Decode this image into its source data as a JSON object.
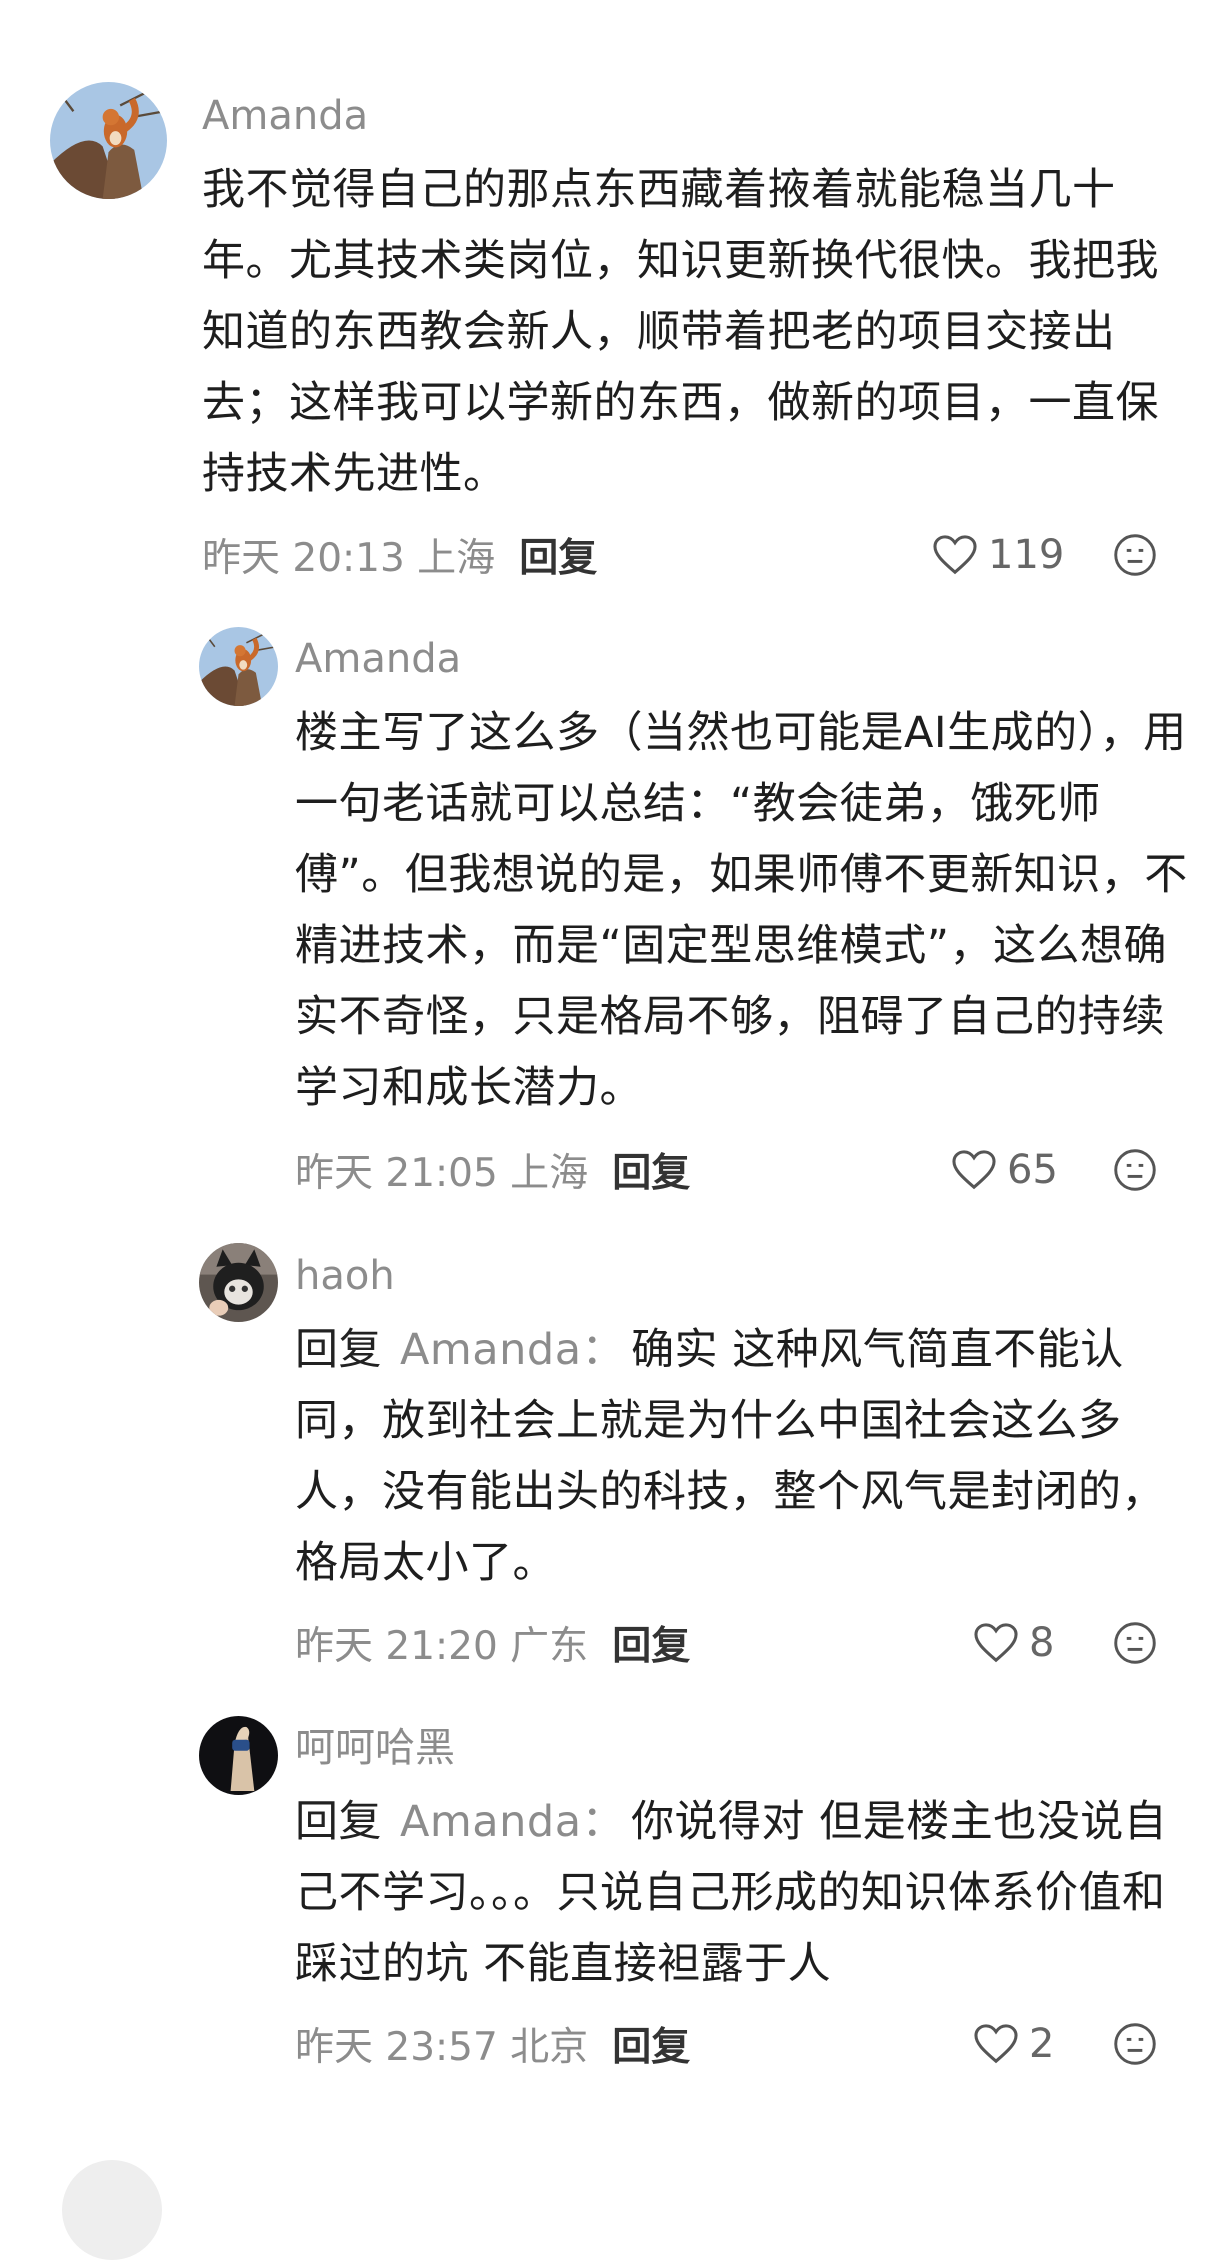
{
  "comments": [
    {
      "author": "Amanda",
      "text": "我不觉得自己的那点东西藏着掖着就能稳当几十年。尤其技术类岗位，知识更新换代很快。我把我知道的东西教会新人，顺带着把老的项目交接出去；这样我可以学新的东西，做新的项目，一直保持技术先进性。",
      "time": "昨天 20:13 上海",
      "reply_label": "回复",
      "likes": "119",
      "avatar_icon": "squirrel-avatar"
    },
    {
      "author": "Amanda",
      "text": "楼主写了这么多（当然也可能是AI生成的），用一句老话就可以总结：“教会徒弟，饿死师傅”。但我想说的是，如果师傅不更新知识，不精进技术，而是“固定型思维模式”，这么想确实不奇怪，只是格局不够，阻碍了自己的持续学习和成长潜力。",
      "time": "昨天 21:05 上海",
      "reply_label": "回复",
      "likes": "65",
      "avatar_icon": "squirrel-avatar"
    },
    {
      "author": "haoh",
      "reply_prefix": "回复",
      "reply_target": "Amanda：",
      "text": "确实 这种风气简直不能认同，放到社会上就是为什么中国社会这么多人，没有能出头的科技，整个风气是封闭的，格局太小了。",
      "time": "昨天 21:20 广东",
      "reply_label": "回复",
      "likes": "8",
      "avatar_icon": "cat-mask-avatar"
    },
    {
      "author": "呵呵哈黑",
      "reply_prefix": "回复",
      "reply_target": "Amanda：",
      "text": "你说得对 但是楼主也没说自己不学习。。。只说自己形成的知识体系价值和踩过的坑 不能直接袒露于人",
      "time": "昨天 23:57 北京",
      "reply_label": "回复",
      "likes": "2",
      "avatar_icon": "hand-avatar"
    }
  ]
}
